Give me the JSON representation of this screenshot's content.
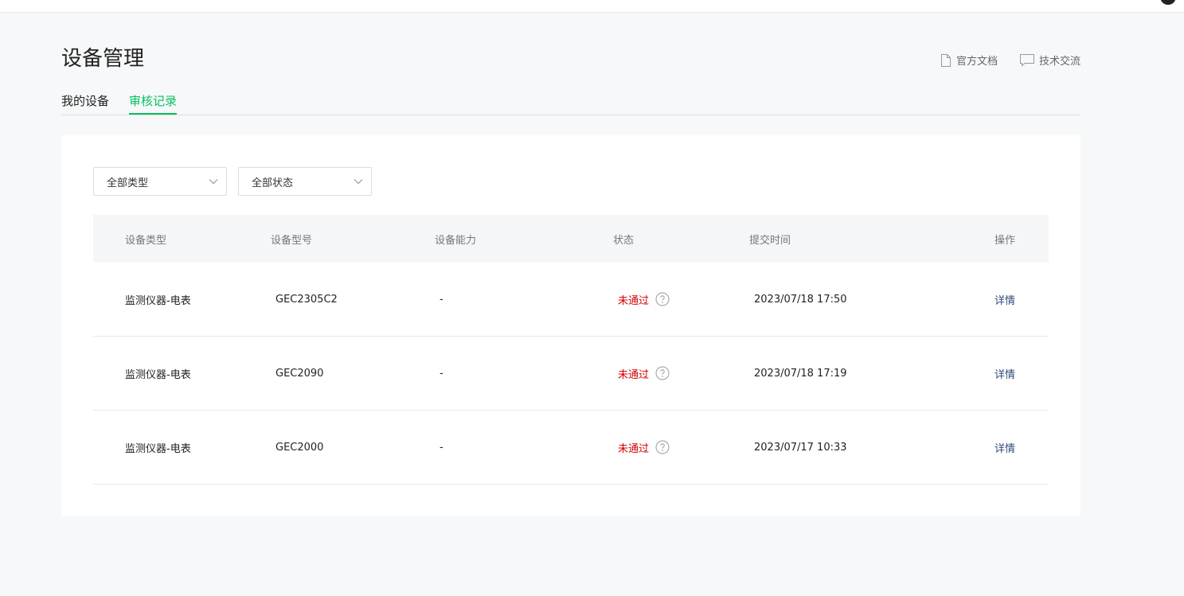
{
  "header": {
    "title": "设备管理",
    "links": [
      {
        "label": "官方文档",
        "icon": "document-icon"
      },
      {
        "label": "技术交流",
        "icon": "chat-bubble-icon"
      }
    ]
  },
  "tabs": [
    {
      "label": "我的设备",
      "active": false
    },
    {
      "label": "审核记录",
      "active": true
    }
  ],
  "filters": [
    {
      "label": "全部类型"
    },
    {
      "label": "全部状态"
    }
  ],
  "table": {
    "columns": [
      "设备类型",
      "设备型号",
      "设备能力",
      "状态",
      "提交时间",
      "操作"
    ],
    "rows": [
      {
        "type": "监测仪器-电表",
        "model": "GEC2305C2",
        "capability": "-",
        "status": "未通过",
        "time": "2023/07/18 17:50",
        "action": "详情"
      },
      {
        "type": "监测仪器-电表",
        "model": "GEC2090",
        "capability": "-",
        "status": "未通过",
        "time": "2023/07/18 17:19",
        "action": "详情"
      },
      {
        "type": "监测仪器-电表",
        "model": "GEC2000",
        "capability": "-",
        "status": "未通过",
        "time": "2023/07/17 10:33",
        "action": "详情"
      }
    ]
  },
  "colors": {
    "accent": "#07c160",
    "fail": "#d40000",
    "link": "#2c4a7a"
  }
}
